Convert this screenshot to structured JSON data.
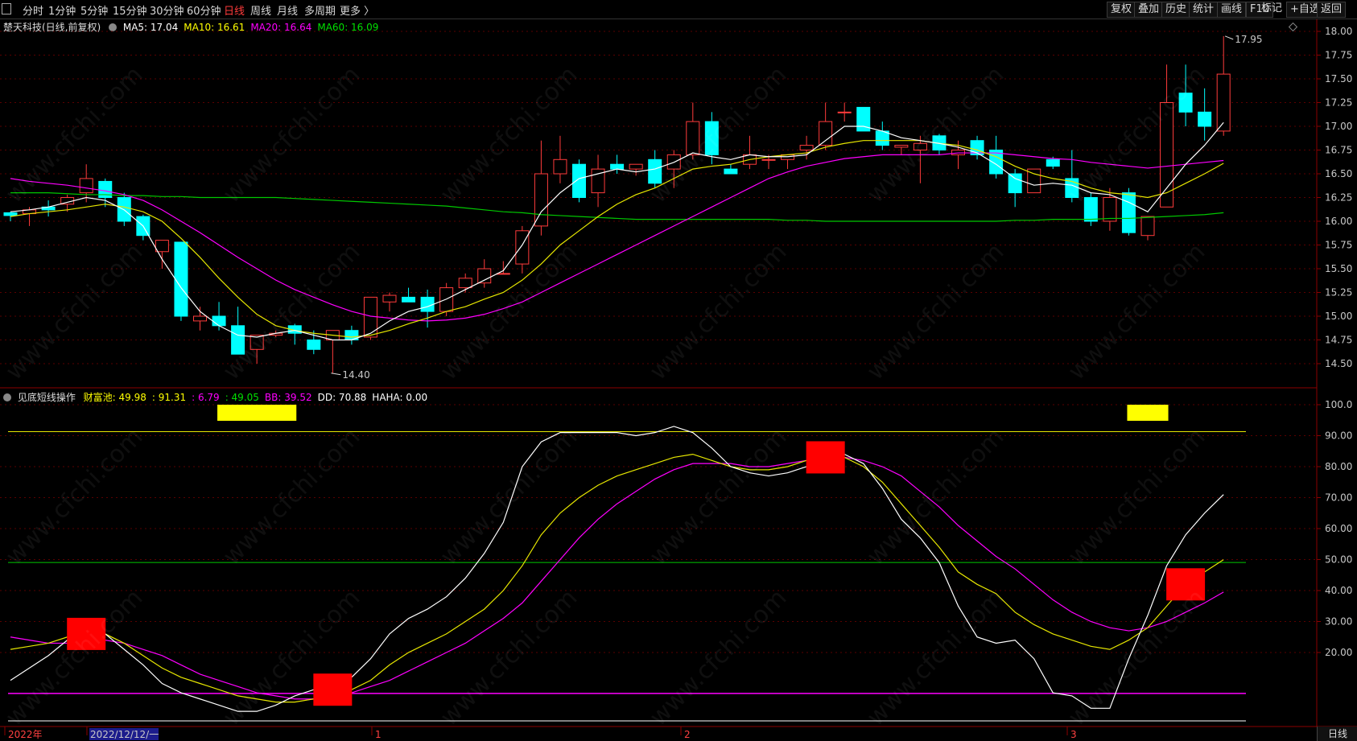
{
  "toolbar": {
    "period_tabs": [
      "分时",
      "1分钟",
      "5分钟",
      "15分钟",
      "30分钟",
      "60分钟",
      "日线",
      "周线",
      "月线",
      "多周期",
      "更多 〉"
    ],
    "active_tab": "日线",
    "right_buttons": [
      "复权",
      "叠加",
      "历史",
      "统计",
      "画线",
      "F10",
      "+自选",
      "返回"
    ],
    "mark_label": "标记"
  },
  "main_chart": {
    "title": "楚天科技(日线,前复权)",
    "indicators": [
      {
        "label": "MA5: 17.04",
        "color": "#ffffff"
      },
      {
        "label": "MA10: 16.61",
        "color": "#ffff00"
      },
      {
        "label": "MA20: 16.64",
        "color": "#ff00ff"
      },
      {
        "label": "MA60: 16.09",
        "color": "#00e000"
      }
    ],
    "high_label": "17.95",
    "low_label": "14.40",
    "y_ticks": [
      "18.00",
      "17.75",
      "17.50",
      "17.25",
      "17.00",
      "16.75",
      "16.50",
      "16.25",
      "16.00",
      "15.75",
      "15.50",
      "15.25",
      "15.00",
      "14.75",
      "14.50"
    ]
  },
  "sub_chart": {
    "title": "见底短线操作",
    "indicators": [
      {
        "label": "财富池: 49.98",
        "color": "#ffff00"
      },
      {
        "label": ": 91.31",
        "color": "#ffff00"
      },
      {
        "label": ": 6.79",
        "color": "#ff00ff"
      },
      {
        "label": ": 49.05",
        "color": "#00e000"
      },
      {
        "label": "BB: 39.52",
        "color": "#ff00ff"
      },
      {
        "label": "DD: 70.88",
        "color": "#ffffff"
      },
      {
        "label": "HAHA: 0.00",
        "color": "#ffffff"
      }
    ],
    "y_ticks": [
      "100.0",
      "90.00",
      "80.00",
      "70.00",
      "60.00",
      "50.00",
      "40.00",
      "30.00",
      "20.00"
    ]
  },
  "x_axis": {
    "labels": [
      "2022年",
      "2022/12/12/一",
      "1",
      "2",
      "3"
    ],
    "highlight_label": "2022/12/12/一"
  },
  "status": {
    "period": "日线"
  },
  "watermark": "www.cfchi.com",
  "chart_data": {
    "type": "candlestick",
    "series_ohlc": [
      [
        16.09,
        16.1,
        16.0,
        16.06
      ],
      [
        16.08,
        16.15,
        15.95,
        16.12
      ],
      [
        16.15,
        16.22,
        16.05,
        16.12
      ],
      [
        16.18,
        16.28,
        16.1,
        16.25
      ],
      [
        16.3,
        16.6,
        16.2,
        16.45
      ],
      [
        16.42,
        16.45,
        16.15,
        16.25
      ],
      [
        16.25,
        16.3,
        15.95,
        16.0
      ],
      [
        16.05,
        16.07,
        15.8,
        15.85
      ],
      [
        15.68,
        15.8,
        15.5,
        15.8
      ],
      [
        15.78,
        15.78,
        14.95,
        15.0
      ],
      [
        14.95,
        15.1,
        14.85,
        15.0
      ],
      [
        15.0,
        15.15,
        14.85,
        14.9
      ],
      [
        14.9,
        15.1,
        14.6,
        14.6
      ],
      [
        14.65,
        14.8,
        14.5,
        14.8
      ],
      [
        14.8,
        14.85,
        14.78,
        14.82
      ],
      [
        14.9,
        14.92,
        14.7,
        14.82
      ],
      [
        14.75,
        14.85,
        14.6,
        14.65
      ],
      [
        14.75,
        14.85,
        14.4,
        14.85
      ],
      [
        14.85,
        14.9,
        14.7,
        14.75
      ],
      [
        14.78,
        15.2,
        14.75,
        15.2
      ],
      [
        15.15,
        15.25,
        15.05,
        15.22
      ],
      [
        15.2,
        15.3,
        15.15,
        15.15
      ],
      [
        15.2,
        15.28,
        14.88,
        15.05
      ],
      [
        15.05,
        15.35,
        15.0,
        15.3
      ],
      [
        15.3,
        15.45,
        15.25,
        15.4
      ],
      [
        15.35,
        15.6,
        15.3,
        15.5
      ],
      [
        15.45,
        15.58,
        15.45,
        15.45
      ],
      [
        15.55,
        15.95,
        15.45,
        15.9
      ],
      [
        15.95,
        16.85,
        15.85,
        16.5
      ],
      [
        16.5,
        16.9,
        16.4,
        16.65
      ],
      [
        16.6,
        16.65,
        16.2,
        16.25
      ],
      [
        16.3,
        16.7,
        16.15,
        16.55
      ],
      [
        16.6,
        16.7,
        16.5,
        16.55
      ],
      [
        16.55,
        16.6,
        16.48,
        16.6
      ],
      [
        16.65,
        16.75,
        16.35,
        16.4
      ],
      [
        16.55,
        16.75,
        16.35,
        16.7
      ],
      [
        16.7,
        17.25,
        16.65,
        17.05
      ],
      [
        17.05,
        17.15,
        16.6,
        16.7
      ],
      [
        16.55,
        16.6,
        16.5,
        16.5
      ],
      [
        16.6,
        16.9,
        16.55,
        16.7
      ],
      [
        16.65,
        16.7,
        16.55,
        16.65
      ],
      [
        16.65,
        16.7,
        16.55,
        16.7
      ],
      [
        16.75,
        16.9,
        16.65,
        16.8
      ],
      [
        16.8,
        17.25,
        16.75,
        17.05
      ],
      [
        17.15,
        17.25,
        17.05,
        17.15
      ],
      [
        17.2,
        17.2,
        17.0,
        16.95
      ],
      [
        16.95,
        17.05,
        16.75,
        16.8
      ],
      [
        16.78,
        16.8,
        16.7,
        16.8
      ],
      [
        16.75,
        16.9,
        16.4,
        16.82
      ],
      [
        16.9,
        16.92,
        16.7,
        16.75
      ],
      [
        16.7,
        16.85,
        16.55,
        16.75
      ],
      [
        16.85,
        16.9,
        16.65,
        16.7
      ],
      [
        16.75,
        16.9,
        16.45,
        16.5
      ],
      [
        16.5,
        16.55,
        16.15,
        16.3
      ],
      [
        16.3,
        16.55,
        16.3,
        16.55
      ],
      [
        16.65,
        16.68,
        16.55,
        16.58
      ],
      [
        16.45,
        16.75,
        16.2,
        16.25
      ],
      [
        16.25,
        16.3,
        15.95,
        16.0
      ],
      [
        16.0,
        16.35,
        15.9,
        16.25
      ],
      [
        16.3,
        16.35,
        15.85,
        15.88
      ],
      [
        15.85,
        16.05,
        15.8,
        16.05
      ],
      [
        16.15,
        17.65,
        16.15,
        17.25
      ],
      [
        17.35,
        17.65,
        17.0,
        17.15
      ],
      [
        17.15,
        17.4,
        16.85,
        17.0
      ],
      [
        16.95,
        17.95,
        16.9,
        17.55
      ]
    ],
    "ma5": [
      16.1,
      16.12,
      16.15,
      16.2,
      16.25,
      16.22,
      16.12,
      15.95,
      15.6,
      15.3,
      15.05,
      14.9,
      14.8,
      14.78,
      14.82,
      14.85,
      14.8,
      14.75,
      14.75,
      14.82,
      14.95,
      15.05,
      15.1,
      15.18,
      15.28,
      15.38,
      15.48,
      15.75,
      16.1,
      16.3,
      16.45,
      16.5,
      16.55,
      16.52,
      16.55,
      16.62,
      16.72,
      16.68,
      16.65,
      16.7,
      16.68,
      16.68,
      16.7,
      16.85,
      17.0,
      17.0,
      16.95,
      16.88,
      16.85,
      16.82,
      16.78,
      16.72,
      16.6,
      16.45,
      16.38,
      16.4,
      16.38,
      16.3,
      16.28,
      16.2,
      16.1,
      16.35,
      16.6,
      16.8,
      17.04
    ],
    "ma10": [
      16.05,
      16.08,
      16.1,
      16.12,
      16.15,
      16.18,
      16.15,
      16.1,
      16.0,
      15.82,
      15.62,
      15.4,
      15.2,
      15.02,
      14.9,
      14.85,
      14.82,
      14.8,
      14.78,
      14.8,
      14.85,
      14.92,
      14.98,
      15.05,
      15.1,
      15.18,
      15.25,
      15.38,
      15.55,
      15.75,
      15.9,
      16.05,
      16.18,
      16.28,
      16.35,
      16.45,
      16.55,
      16.58,
      16.6,
      16.65,
      16.68,
      16.7,
      16.72,
      16.78,
      16.82,
      16.85,
      16.85,
      16.85,
      16.85,
      16.82,
      16.8,
      16.75,
      16.68,
      16.58,
      16.5,
      16.45,
      16.42,
      16.35,
      16.3,
      16.28,
      16.25,
      16.3,
      16.4,
      16.5,
      16.61
    ],
    "ma20": [
      16.45,
      16.42,
      16.4,
      16.38,
      16.35,
      16.32,
      16.28,
      16.22,
      16.12,
      16.0,
      15.88,
      15.75,
      15.62,
      15.5,
      15.38,
      15.28,
      15.2,
      15.12,
      15.05,
      15.0,
      14.98,
      14.96,
      14.95,
      14.96,
      14.98,
      15.02,
      15.08,
      15.15,
      15.25,
      15.35,
      15.45,
      15.55,
      15.65,
      15.75,
      15.85,
      15.95,
      16.05,
      16.15,
      16.25,
      16.35,
      16.45,
      16.52,
      16.58,
      16.62,
      16.66,
      16.68,
      16.7,
      16.7,
      16.7,
      16.7,
      16.72,
      16.72,
      16.72,
      16.7,
      16.68,
      16.66,
      16.65,
      16.62,
      16.6,
      16.58,
      16.56,
      16.58,
      16.6,
      16.62,
      16.64
    ],
    "ma60": [
      16.3,
      16.3,
      16.3,
      16.29,
      16.28,
      16.28,
      16.27,
      16.27,
      16.26,
      16.26,
      16.25,
      16.25,
      16.25,
      16.25,
      16.25,
      16.24,
      16.23,
      16.22,
      16.21,
      16.2,
      16.19,
      16.18,
      16.17,
      16.16,
      16.14,
      16.12,
      16.1,
      16.09,
      16.07,
      16.06,
      16.05,
      16.04,
      16.03,
      16.02,
      16.02,
      16.02,
      16.02,
      16.02,
      16.02,
      16.02,
      16.02,
      16.01,
      16.01,
      16.0,
      16.0,
      16.0,
      16.0,
      16.0,
      16.0,
      16.0,
      16.0,
      16.0,
      16.0,
      16.01,
      16.01,
      16.02,
      16.02,
      16.02,
      16.03,
      16.03,
      16.04,
      16.05,
      16.06,
      16.07,
      16.09
    ],
    "dd": [
      11,
      15,
      19,
      24,
      28,
      26,
      21,
      16,
      10,
      7,
      5,
      3,
      1,
      1,
      3,
      6,
      8,
      10,
      12,
      18,
      26,
      31,
      34,
      38,
      44,
      52,
      62,
      80,
      88,
      91,
      91,
      91,
      91,
      90,
      91,
      93,
      91,
      86,
      80,
      78,
      77,
      78,
      80,
      83,
      84,
      81,
      73,
      63,
      57,
      49,
      35,
      25,
      23,
      24,
      18,
      7,
      6,
      2,
      2,
      18,
      32,
      48,
      58,
      65,
      71
    ],
    "caifuchi": [
      21,
      22,
      23,
      25,
      26,
      26,
      23,
      19,
      15,
      12,
      10,
      8,
      6,
      5,
      4,
      4,
      5,
      6,
      8,
      11,
      16,
      20,
      23,
      26,
      30,
      34,
      40,
      48,
      58,
      65,
      70,
      74,
      77,
      79,
      81,
      83,
      84,
      82,
      80,
      79,
      79,
      80,
      82,
      83,
      83,
      80,
      75,
      68,
      61,
      54,
      46,
      42,
      39,
      33,
      29,
      26,
      24,
      22,
      21,
      24,
      28,
      35,
      42,
      46,
      49.98
    ],
    "bb": [
      25,
      24,
      23,
      23,
      24,
      24,
      23,
      21,
      19,
      16,
      13,
      11,
      9,
      7,
      6,
      5,
      5,
      6,
      7,
      9,
      11,
      14,
      17,
      20,
      23,
      27,
      31,
      36,
      43,
      50,
      57,
      63,
      68,
      72,
      76,
      79,
      81,
      81,
      81,
      80,
      80,
      81,
      82,
      83,
      83,
      82,
      80,
      77,
      72,
      67,
      61,
      56,
      51,
      47,
      42,
      37,
      33,
      30,
      28,
      27,
      28,
      30,
      33,
      36,
      39.52
    ],
    "signals_red": [
      4,
      17,
      43,
      62
    ],
    "signals_yellow": [
      [
        11,
        15
      ],
      [
        59,
        61
      ]
    ],
    "level_lines": {
      "upper": 91.31,
      "mid": 49.05,
      "lower": 6.79,
      "base": 0
    }
  }
}
